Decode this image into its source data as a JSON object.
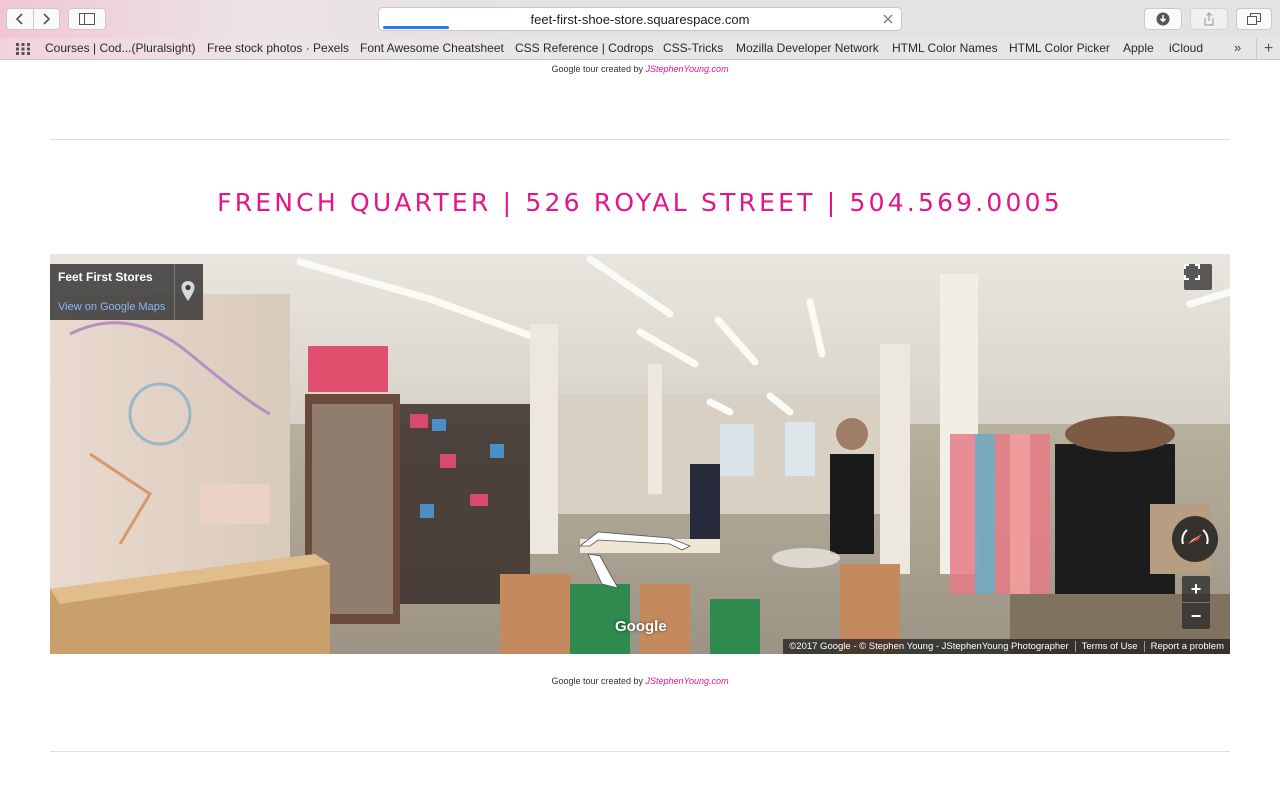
{
  "browser": {
    "url": "feet-first-shoe-store.squarespace.com",
    "bookmarks": [
      "Courses | Cod...(Pluralsight)",
      "Free stock photos · Pexels",
      "Font Awesome Cheatsheet",
      "CSS Reference | Codrops",
      "CSS-Tricks",
      "Mozilla Developer Network",
      "HTML Color Names",
      "HTML Color Picker",
      "Apple",
      "iCloud"
    ],
    "more_label": "»",
    "add_label": "+"
  },
  "page": {
    "credit_top": {
      "prefix": "Google tour created by ",
      "author": "JStephenYoung.com"
    },
    "heading": "FRENCH QUARTER | 526 ROYAL STREET | 504.569.0005",
    "accent_color": "#e4148a",
    "credit_bottom": {
      "prefix": "Google tour created by ",
      "author": "JStephenYoung.com"
    }
  },
  "streetview": {
    "place_name": "Feet First Stores",
    "maps_link": "View on Google Maps",
    "google_logo": "Google",
    "zoom_in": "+",
    "zoom_out": "−",
    "attribution": "©2017 Google - © Stephen Young - JStephenYoung Photographer",
    "terms": "Terms of Use",
    "report": "Report a problem",
    "icons": [
      "map-pin-icon",
      "fullscreen-icon",
      "compass-icon",
      "navigation-arrow-icon"
    ]
  }
}
